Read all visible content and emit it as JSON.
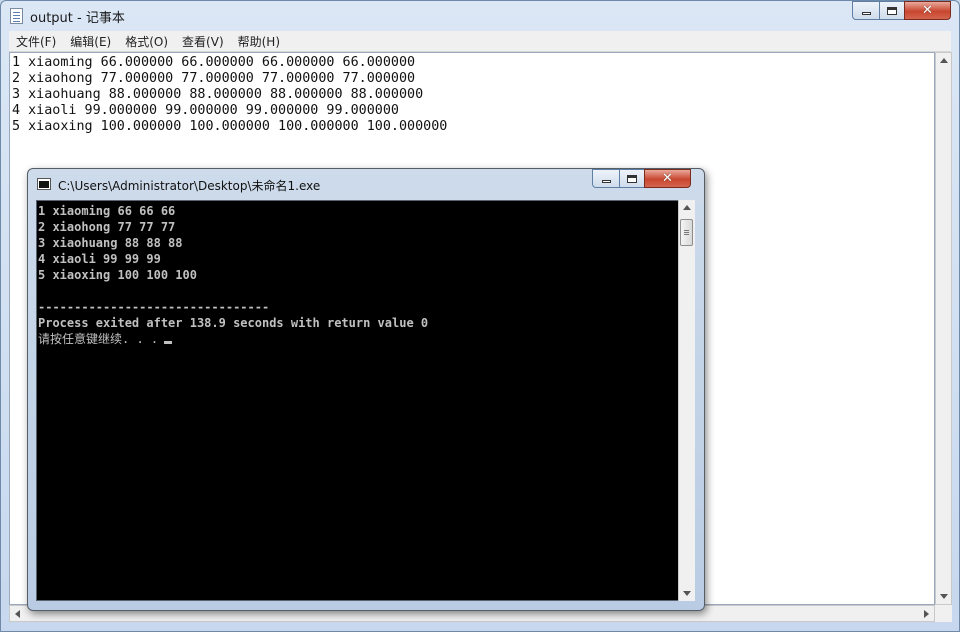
{
  "notepad": {
    "title": "output - 记事本",
    "menu": [
      "文件(F)",
      "编辑(E)",
      "格式(O)",
      "查看(V)",
      "帮助(H)"
    ],
    "lines": [
      "1 xiaoming 66.000000 66.000000 66.000000 66.000000",
      "2 xiaohong 77.000000 77.000000 77.000000 77.000000",
      "3 xiaohuang 88.000000 88.000000 88.000000 88.000000",
      "4 xiaoli 99.000000 99.000000 99.000000 99.000000",
      "5 xiaoxing 100.000000 100.000000 100.000000 100.000000"
    ]
  },
  "console": {
    "title": "C:\\Users\\Administrator\\Desktop\\未命名1.exe",
    "lines": [
      "1 xiaoming 66 66 66",
      "2 xiaohong 77 77 77",
      "3 xiaohuang 88 88 88",
      "4 xiaoli 99 99 99",
      "5 xiaoxing 100 100 100",
      "",
      "--------------------------------",
      "Process exited after 138.9 seconds with return value 0"
    ],
    "prompt": "请按任意键继续. . ."
  },
  "icons": {
    "notepad": "notepad-icon",
    "console": "console-icon",
    "minimize": "minimize-icon",
    "maximize": "maximize-icon",
    "close": "close-icon"
  }
}
